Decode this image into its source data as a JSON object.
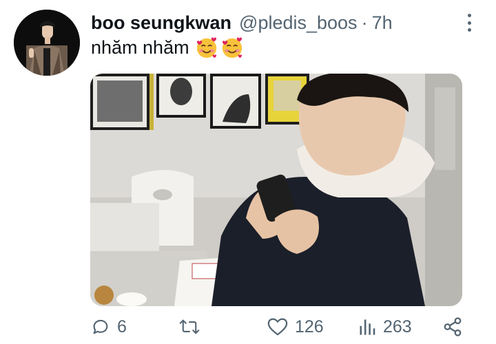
{
  "tweet": {
    "display_name": "boo seungkwan",
    "handle": "@pledis_boos",
    "separator": "·",
    "timestamp": "7h",
    "text": "nhăm nhăm",
    "emojis": [
      "smiling-face-with-hearts",
      "smiling-face-with-hearts"
    ],
    "media": {
      "description_icon": "photo"
    }
  },
  "actions": {
    "reply_count": "6",
    "retweet_count": "",
    "like_count": "126",
    "view_count": "263"
  },
  "colors": {
    "text_primary": "#0f1419",
    "text_secondary": "#536471",
    "background": "#ffffff"
  }
}
